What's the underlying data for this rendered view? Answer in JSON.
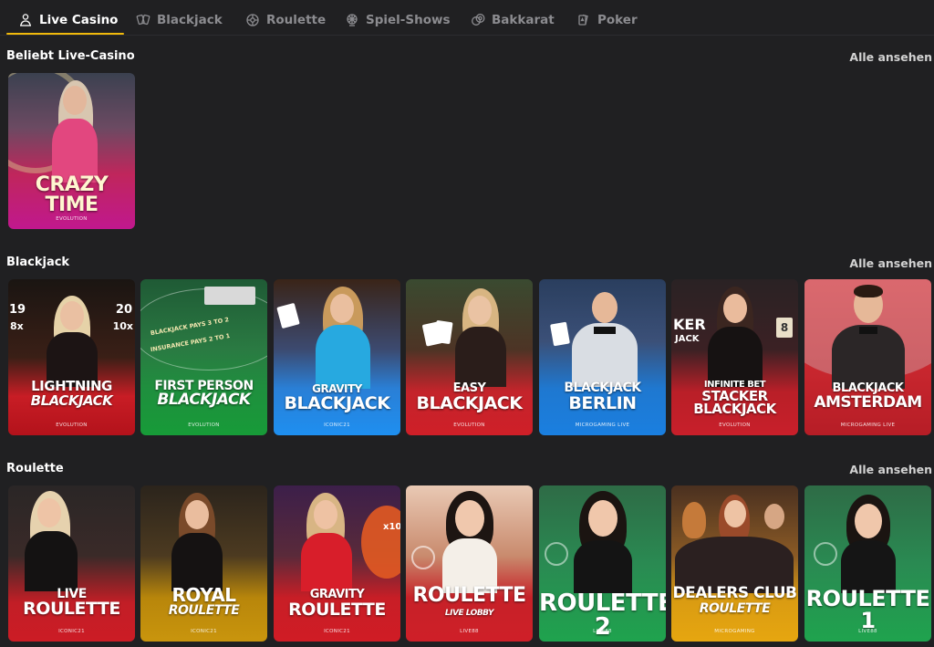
{
  "tabs": [
    {
      "label": "Live Casino",
      "icon": "dealer-icon",
      "active": true
    },
    {
      "label": "Blackjack",
      "icon": "cards-icon",
      "active": false
    },
    {
      "label": "Roulette",
      "icon": "roulette-icon",
      "active": false
    },
    {
      "label": "Spiel-Shows",
      "icon": "game-show-icon",
      "active": false
    },
    {
      "label": "Bakkarat",
      "icon": "chips-icon",
      "active": false
    },
    {
      "label": "Poker",
      "icon": "poker-cards-icon",
      "active": false
    }
  ],
  "accent_color": "#f0b90b",
  "sections": {
    "popular": {
      "title": "Beliebt Live-Casino",
      "see_all": "Alle ansehen",
      "games": [
        {
          "title": "CRAZY TIME",
          "provider": "EVOLUTION"
        }
      ]
    },
    "blackjack": {
      "title": "Blackjack",
      "see_all": "Alle ansehen",
      "games": [
        {
          "line1": "LIGHTNING",
          "line2": "BLACKJACK",
          "provider": "EVOLUTION"
        },
        {
          "line1": "FIRST PERSON",
          "line2": "BLACKJACK",
          "provider": "EVOLUTION"
        },
        {
          "line1": "GRAVITY",
          "line2": "BLACKJACK",
          "provider": "ICONIC21"
        },
        {
          "line1": "EASY",
          "line2": "BLACKJACK",
          "provider": "EVOLUTION"
        },
        {
          "line1": "BLACKJACK",
          "line2": "BERLIN",
          "provider": "MICROGAMING LIVE"
        },
        {
          "line1": "INFINITE BET",
          "line2": "STACKER",
          "line3": "BLACKJACK",
          "provider": "EVOLUTION"
        },
        {
          "line1": "BLACKJACK",
          "line2": "AMSTERDAM",
          "provider": "MICROGAMING LIVE"
        }
      ]
    },
    "roulette": {
      "title": "Roulette",
      "see_all": "Alle ansehen",
      "games": [
        {
          "line1": "LIVE",
          "line2": "ROULETTE",
          "provider": "ICONIC21"
        },
        {
          "line1": "ROYAL",
          "line2": "ROULETTE",
          "provider": "ICONIC21"
        },
        {
          "line1": "GRAVITY",
          "line2": "ROULETTE",
          "provider": "ICONIC21"
        },
        {
          "line1": "ROULETTE",
          "line2": "LIVE LOBBY",
          "provider": "LIVE88"
        },
        {
          "line1": "ROULETTE 2",
          "provider": "LIVE88"
        },
        {
          "line1": "DEALERS CLUB",
          "line2": "ROULETTE",
          "provider": "MICROGAMING"
        },
        {
          "line1": "ROULETTE 1",
          "provider": "LIVE88"
        }
      ]
    }
  },
  "card_extras": {
    "lightning_left_top": "19",
    "lightning_left_bottom": "8x",
    "lightning_right_top": "20",
    "lightning_right_bottom": "10x",
    "stacker_partial_text": "KER",
    "stacker_partial_sub": "JACK",
    "stacker_badge": "8",
    "first_person_table_text1": "BLACKJACK PAYS 3 TO 2",
    "first_person_table_text2": "INSURANCE PAYS 2 TO 1",
    "gravity_roulette_multiplier": "x10"
  }
}
